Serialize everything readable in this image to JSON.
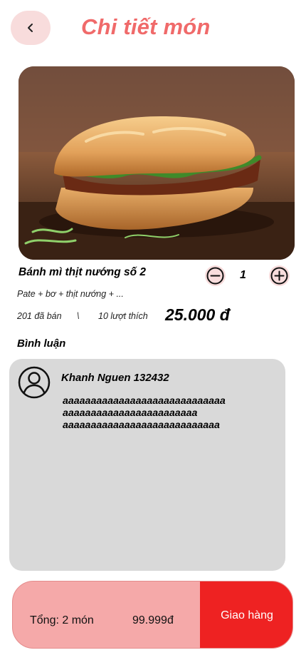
{
  "header": {
    "title": "Chi tiết món",
    "back_icon": "chevron-left-icon"
  },
  "product": {
    "name": "Bánh mì thịt nướng số 2",
    "description": "Pate + bơ + thịt nướng + ...",
    "sold": "201  đã bán",
    "separator": "\\",
    "likes": "10 lượt thích",
    "price": "25.000 đ",
    "quantity": "1"
  },
  "comments": {
    "heading": "Bình luận",
    "items": [
      {
        "user": "Khanh Nguen 132432",
        "text": "aaaaaaaaaaaaaaaaaaaaaaaaaaaaa\naaaaaaaaaaaaaaaaaaaaaaaa\naaaaaaaaaaaaaaaaaaaaaaaaaaaa"
      }
    ]
  },
  "footer": {
    "total_label": "Tổng: 2 món",
    "total_price": "99.999đ",
    "order_label": "Giao hàng"
  },
  "colors": {
    "accent": "#f06a6a",
    "pink_light": "#f8dcdc",
    "bar_bg": "#f5a9a9",
    "order_red": "#ee2222",
    "card_gray": "#d9d9d9"
  }
}
